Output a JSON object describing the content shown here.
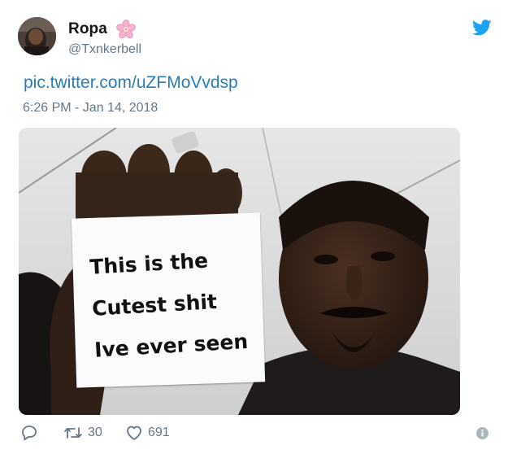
{
  "tweet": {
    "display_name": "Ropa",
    "name_emoji": "cherry-blossom-icon",
    "handle": "@Txnkerbell",
    "link_text": "pic.twitter.com/uZFMoVvdsp",
    "timestamp": "6:26 PM - Jan 14, 2018",
    "meme_sign_lines": [
      "This is the",
      "Cutest shit",
      "Ive ever seen"
    ],
    "retweet_count": "30",
    "like_count": "691"
  },
  "icons": [
    "twitter-bird-icon",
    "reply-icon",
    "retweet-icon",
    "heart-icon",
    "info-icon"
  ],
  "colors": {
    "link": "#2b7bb9",
    "secondary_text": "#657786",
    "twitter_blue": "#1da1f2",
    "flower_pink": "#f4a6c3"
  }
}
